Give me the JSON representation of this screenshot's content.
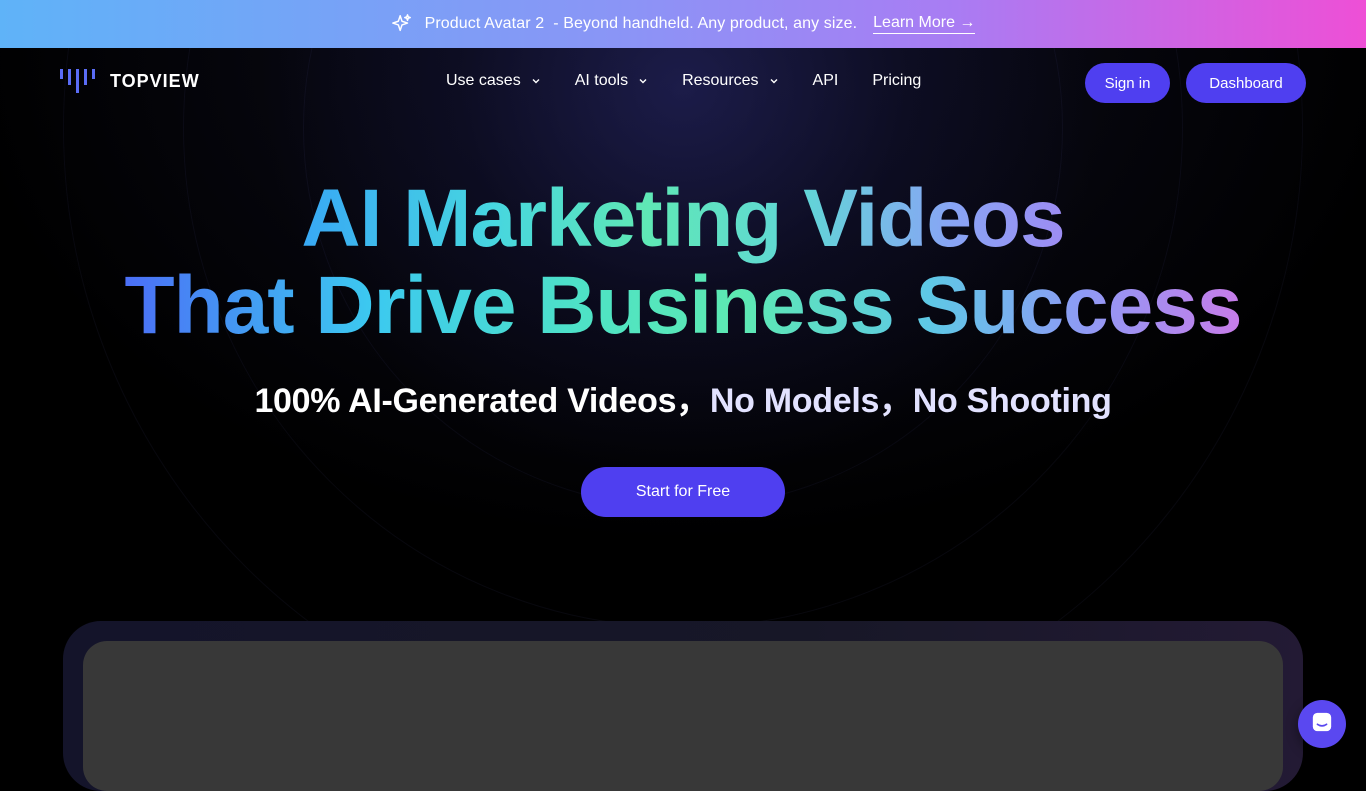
{
  "announcement": {
    "icon": "sparkle-icon",
    "message": "Product Avatar 2  - Beyond handheld. Any product, any size.",
    "link_label": "Learn More →"
  },
  "nav": {
    "logo_text": "TOPVIEW",
    "items": [
      {
        "label": "Use cases",
        "has_dropdown": true
      },
      {
        "label": "AI tools",
        "has_dropdown": true
      },
      {
        "label": "Resources",
        "has_dropdown": true
      },
      {
        "label": "API",
        "has_dropdown": false
      },
      {
        "label": "Pricing",
        "has_dropdown": false
      }
    ],
    "sign_in_label": "Sign in",
    "dashboard_label": "Dashboard"
  },
  "hero": {
    "headline_line1": "AI Marketing Videos",
    "headline_line2": "That Drive Business Success",
    "subheadline_part1": "100% AI-Generated Videos，",
    "subheadline_part2": "No Models，",
    "subheadline_part3": "No Shooting",
    "cta_label": "Start for Free"
  },
  "colors": {
    "accent": "#4f3ff0",
    "background": "#000000",
    "banner_gradient_start": "#5fb3f8",
    "banner_gradient_end": "#ee4fd6"
  },
  "chat_widget": {
    "icon": "chat-icon"
  }
}
